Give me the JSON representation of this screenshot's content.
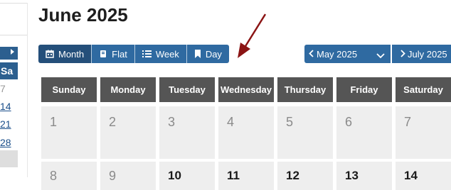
{
  "title": "June 2025",
  "mini_calendar": {
    "header": "Sa",
    "days": [
      "7",
      "14",
      "21",
      "28"
    ]
  },
  "views": [
    {
      "label": "Month",
      "icon": "calendar-icon",
      "active": true
    },
    {
      "label": "Flat",
      "icon": "book-icon",
      "active": false
    },
    {
      "label": "Week",
      "icon": "list-icon",
      "active": false
    },
    {
      "label": "Day",
      "icon": "bookmark-icon",
      "active": false
    }
  ],
  "navigation": {
    "prev_label": "May 2025",
    "next_label": "July 2025"
  },
  "calendar": {
    "weekdays": [
      "Sunday",
      "Monday",
      "Tuesday",
      "Wednesday",
      "Thursday",
      "Friday",
      "Saturday"
    ],
    "week1": [
      "1",
      "2",
      "3",
      "4",
      "5",
      "6",
      "7"
    ],
    "week2": [
      "8",
      "9",
      "10",
      "11",
      "12",
      "13",
      "14"
    ]
  },
  "colors": {
    "button": "#2f6aa1",
    "button_active": "#244f7a",
    "weekday_header": "#555555",
    "cell": "#eeeeee",
    "annotation": "#8b1414"
  }
}
